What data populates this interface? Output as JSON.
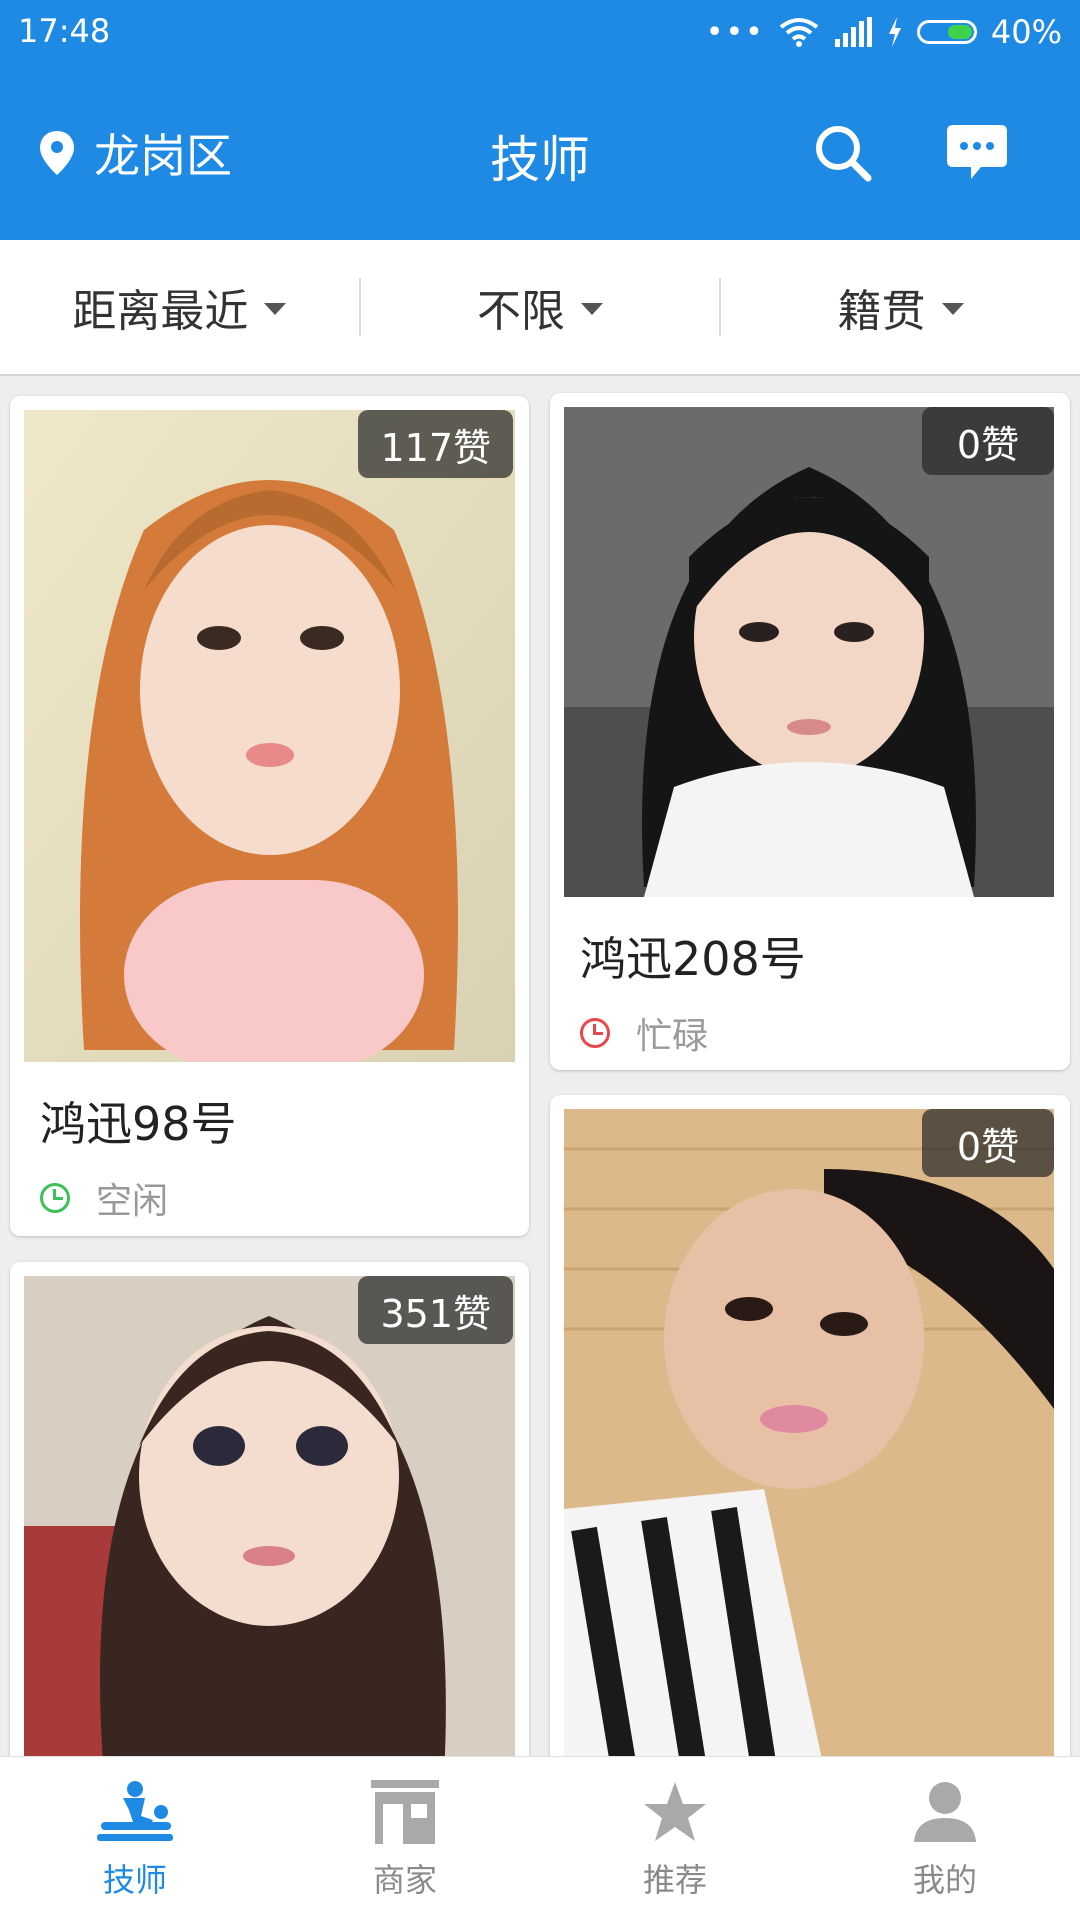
{
  "status_bar": {
    "time": "17:48",
    "signal_dots": "•••",
    "battery": "40%"
  },
  "header": {
    "location": "龙岗区",
    "title": "技师",
    "search_icon": "search-icon",
    "message_icon": "chat-bubble-icon"
  },
  "filters": [
    {
      "label": "距离最近"
    },
    {
      "label": "不限"
    },
    {
      "label": "籍贯"
    }
  ],
  "cards": [
    {
      "likes": "117赞",
      "name": "鸿迅98号",
      "status": "空闲",
      "status_color": "#3cc05a"
    },
    {
      "likes": "0赞",
      "name": "鸿迅208号",
      "status": "忙碌",
      "status_color": "#e8474c"
    },
    {
      "likes": "351赞"
    },
    {
      "likes": "0赞"
    }
  ],
  "bottom_nav": [
    {
      "label": "技师",
      "icon": "massage-icon",
      "active": true
    },
    {
      "label": "商家",
      "icon": "store-icon",
      "active": false
    },
    {
      "label": "推荐",
      "icon": "star-icon",
      "active": false
    },
    {
      "label": "我的",
      "icon": "person-icon",
      "active": false
    }
  ],
  "colors": {
    "primary": "#1f8ae4",
    "idle": "#3cc05a",
    "busy": "#e8474c"
  }
}
